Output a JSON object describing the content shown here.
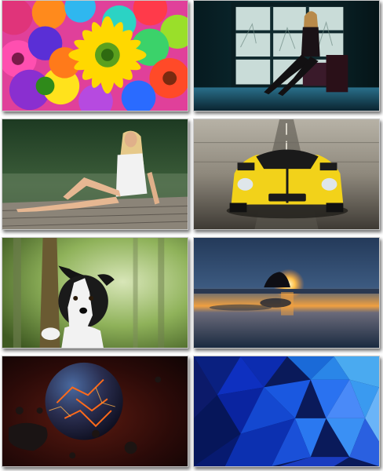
{
  "gallery": {
    "thumbnails": [
      {
        "subject": "colorful-flowers",
        "accent": "#f5c400"
      },
      {
        "subject": "woman-at-window",
        "accent": "#1d3a44"
      },
      {
        "subject": "woman-on-dock",
        "accent": "#3a5a32"
      },
      {
        "subject": "yellow-sports-car",
        "accent": "#f2d21a"
      },
      {
        "subject": "dog-in-forest",
        "accent": "#7da33c"
      },
      {
        "subject": "sunset-rock-beach",
        "accent": "#f08a2a"
      },
      {
        "subject": "exploding-planet",
        "accent": "#e2441a"
      },
      {
        "subject": "blue-polygon-abstract",
        "accent": "#1a5ce0"
      }
    ]
  }
}
